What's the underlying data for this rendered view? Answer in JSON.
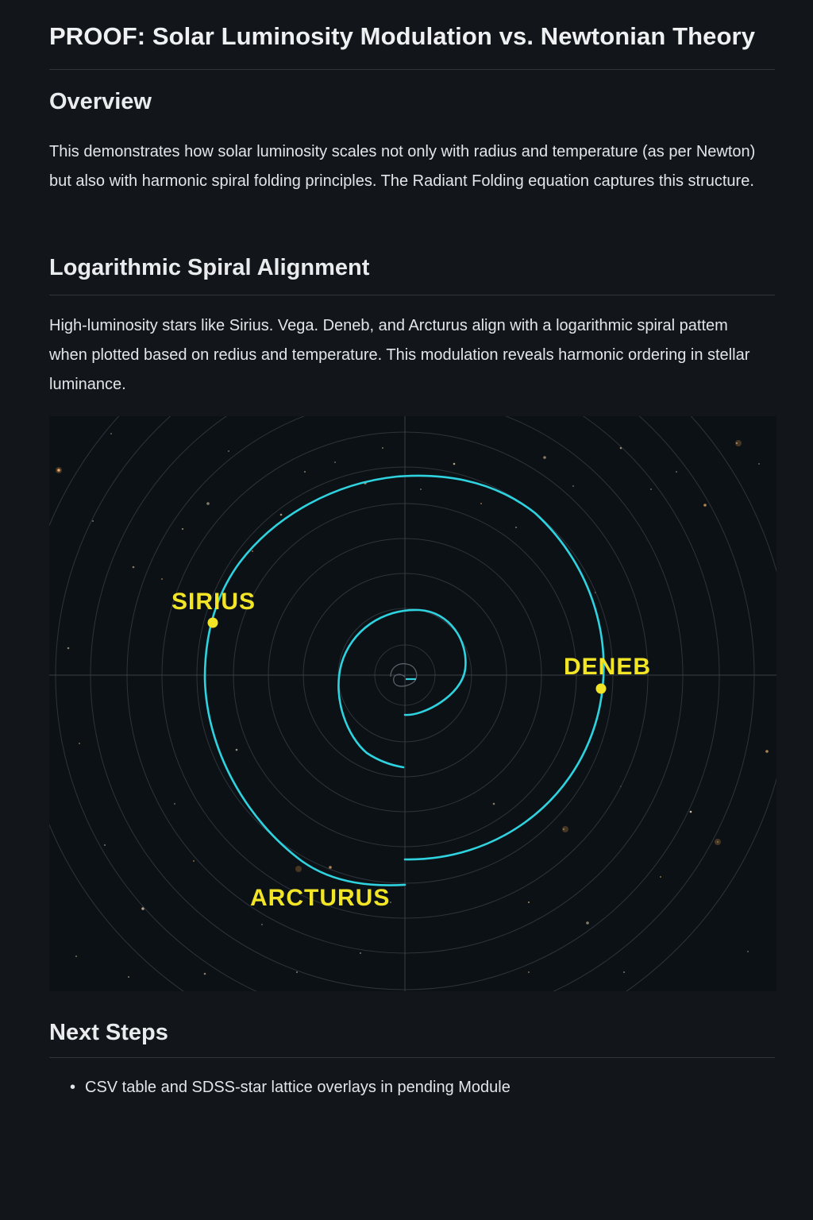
{
  "header": {
    "title": "PROOF:  Solar Luminosity Modulation vs. Newtonian Theory"
  },
  "overview": {
    "heading": "Overview",
    "body": "This demonstrates how solar luminosity scales not only with radius and temperature (as per Newton) but also with harmonic spiral folding principles. The Radiant Folding equation captures this structure."
  },
  "spiral_section": {
    "heading": "Logarithmic Spiral Alignment",
    "body": "High-luminosity stars like Sirius. Vega. Deneb, and Arcturus align with a logarithmic spiral pattem when plotted based on redius and temperature. This modulation reveals harmonic ordering in stellar luminance."
  },
  "figure": {
    "labels": {
      "sirius": "SIRIUS",
      "deneb": "DENEB",
      "arcturus": "ARCTURUS"
    },
    "colors": {
      "spiral": "#2fd3e0",
      "marker": "#f2e526",
      "label": "#f2e526",
      "grid": "#3a4047",
      "background": "#0c1116"
    }
  },
  "next_steps": {
    "heading": "Next Steps",
    "bullet_glyph": "•",
    "items": [
      "CSV table and SDSS-star lattice overlays in pending Module"
    ]
  }
}
